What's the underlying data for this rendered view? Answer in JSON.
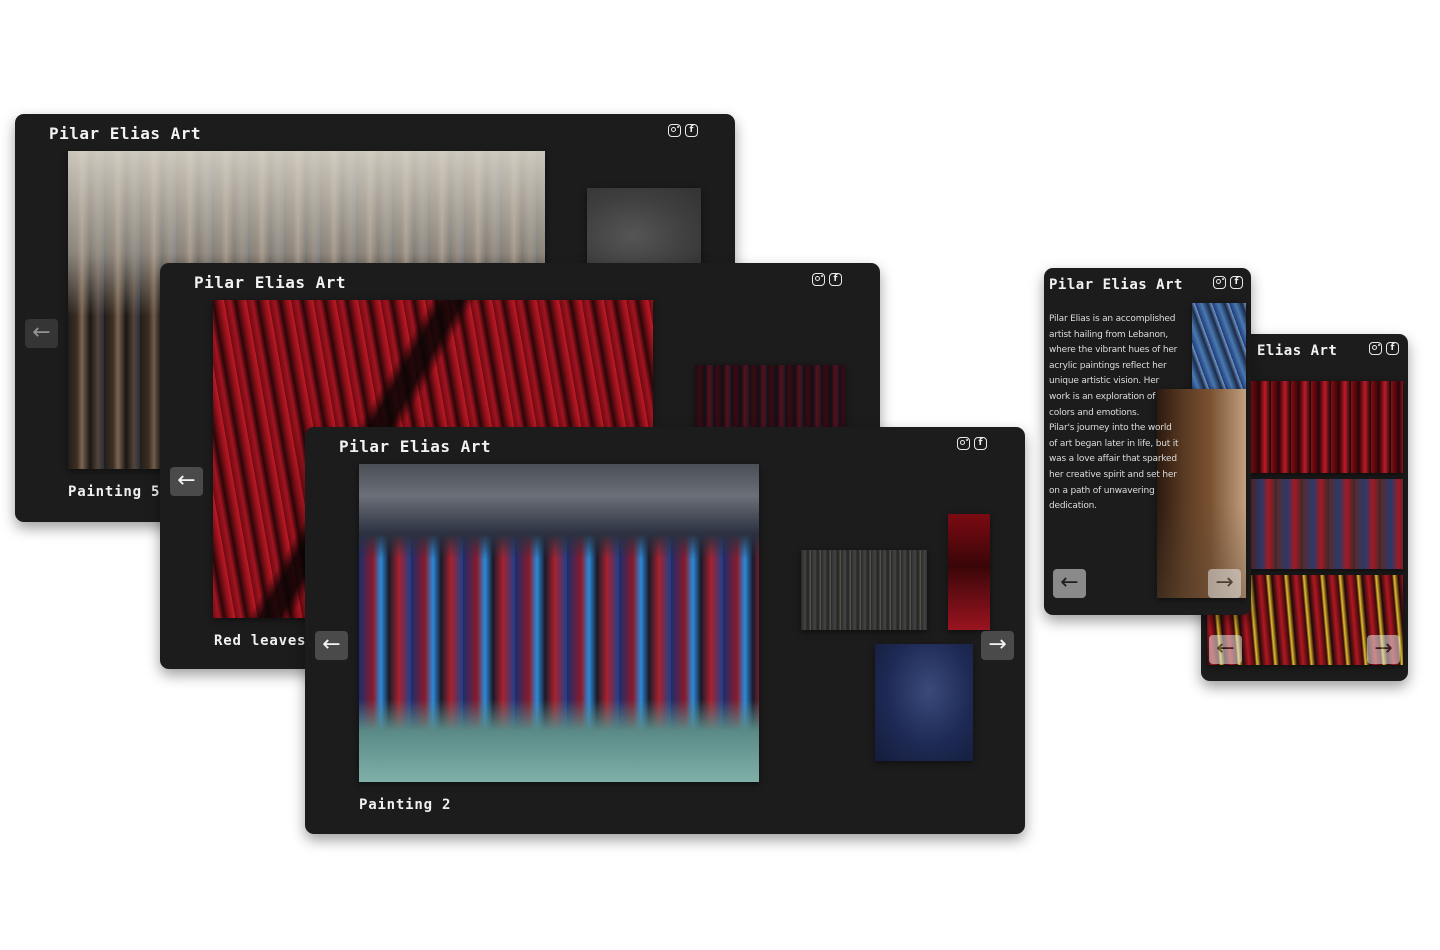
{
  "brand": {
    "title": "Pilar Elias Art",
    "title_cropped": "Elias Art"
  },
  "icons": {
    "instagram": "instagram-icon",
    "facebook": "facebook-icon",
    "facebook_glyph": "f",
    "arrow_left": "←",
    "arrow_right": "→"
  },
  "windows": [
    {
      "caption": "Painting 5"
    },
    {
      "caption": "Red leaves"
    },
    {
      "caption": "Painting 2"
    }
  ],
  "bio": {
    "lines": [
      "Pilar Elias is an accomplished",
      "artist hailing from Lebanon,",
      "where the vibrant hues of her",
      "acrylic paintings reflect her",
      "unique artistic vision. Her",
      "work is an exploration of",
      "colors and emotions.",
      "Pilar's journey into the world",
      "of art began later in life, but it",
      "was a love affair that sparked",
      "her creative spirit and set her",
      "on a path of unwavering",
      "dedication."
    ]
  },
  "colors": {
    "window_bg": "#1c1c1c",
    "page_bg": "#ffffff",
    "arrow_bg": "#4a4a4a"
  }
}
